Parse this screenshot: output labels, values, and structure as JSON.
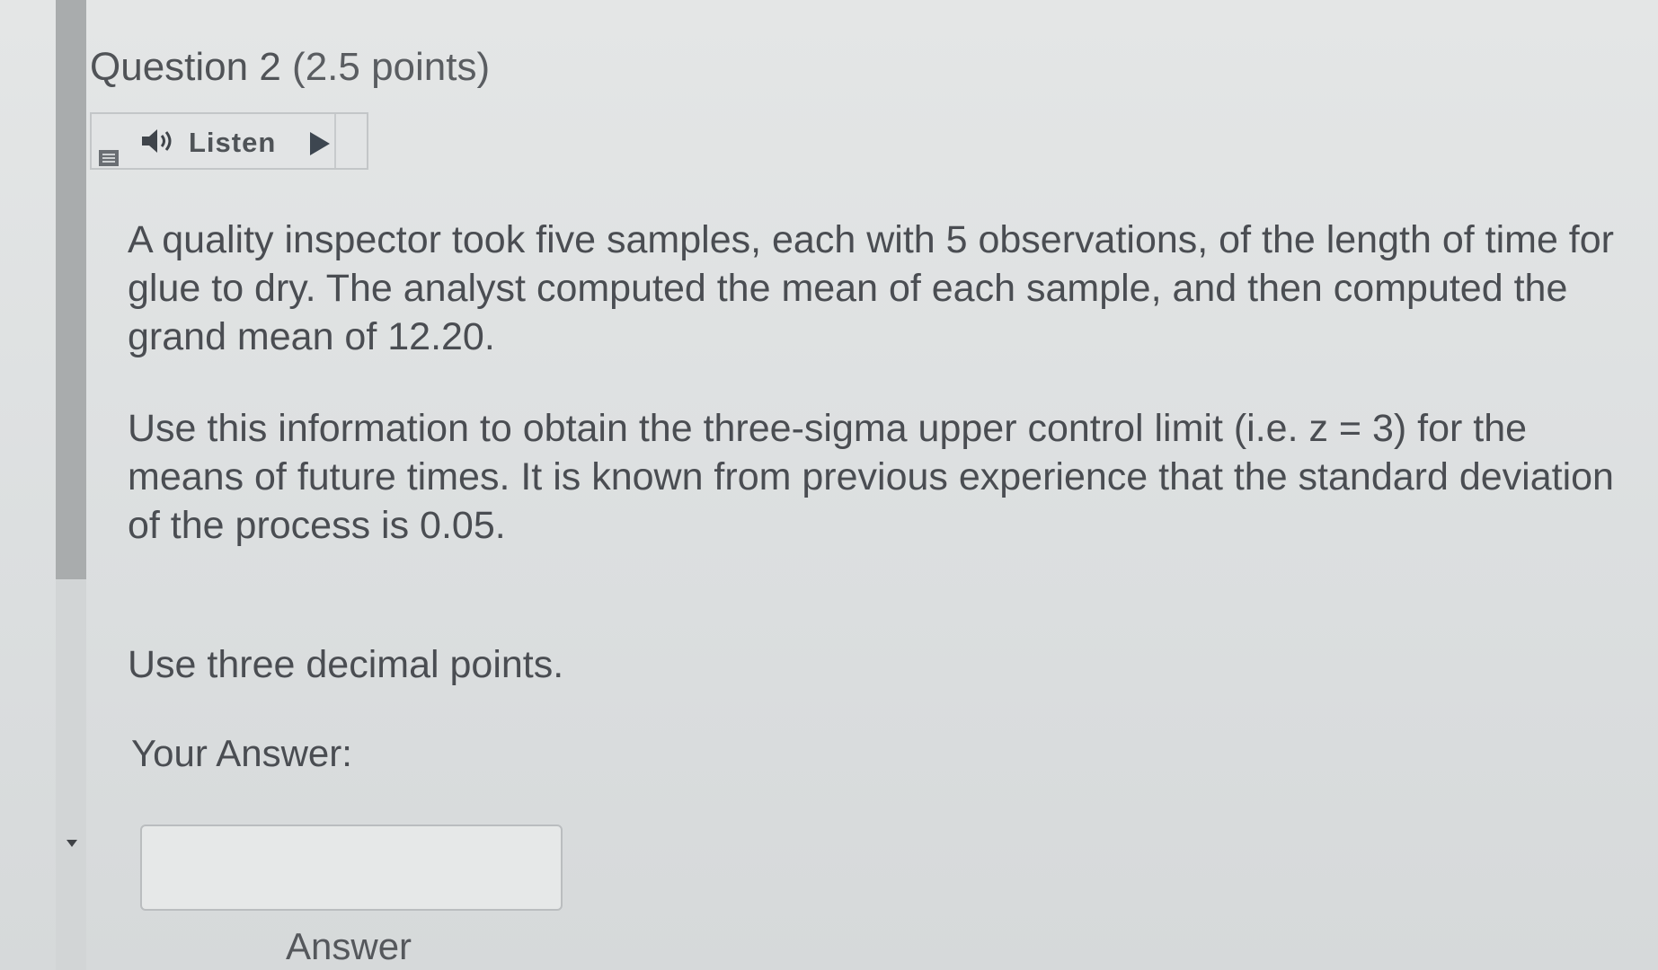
{
  "question": {
    "title": "Question 2",
    "points": "(2.5 points)"
  },
  "toolbar": {
    "menu_icon": "menu-icon",
    "speaker_icon": "speaker-icon",
    "listen_label": "Listen",
    "play_icon": "play-icon"
  },
  "body": {
    "paragraph_1": "A quality inspector took five samples, each with 5 observations, of the length of time for glue to dry. The analyst computed the mean of each sample, and then computed the grand mean of 12.20.",
    "paragraph_2": "Use this information to obtain the three-sigma upper control limit (i.e. z = 3) for the means of future times. It is known from previous experience that the standard deviation of the process is 0.05.",
    "paragraph_3": "Use three decimal points."
  },
  "answer": {
    "label": "Your Answer:",
    "value": "",
    "caption": "Answer"
  },
  "colors": {
    "background": "#dfe1e2",
    "text": "#4a4d52",
    "scrollbar_thumb": "#a9acad",
    "play_icon": "#3d4650"
  }
}
